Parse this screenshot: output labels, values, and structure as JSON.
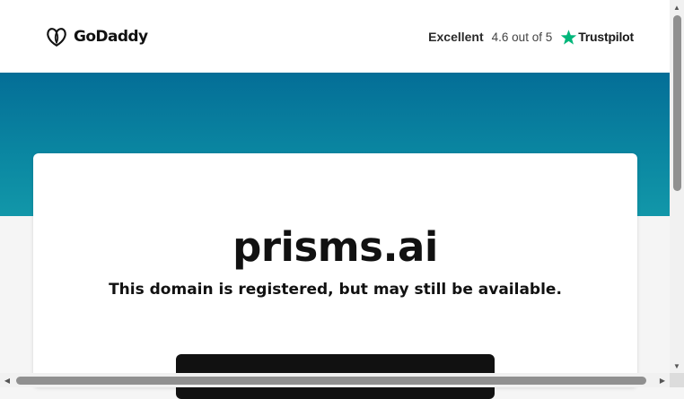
{
  "header": {
    "logo_text": "GoDaddy",
    "rating": {
      "word": "Excellent",
      "score": "4.6 out of 5",
      "brand": "Trustpilot",
      "star_icon": "star-icon",
      "star_color": "#00b67a"
    }
  },
  "hero": {
    "color_top": "#046e97",
    "color_bottom": "#1297a9"
  },
  "card": {
    "domain": "prisms.ai",
    "subtitle": "This domain is registered, but may still be available.",
    "cta_label": ""
  },
  "scrollbars": {
    "up_arrow": "▲",
    "down_arrow": "▼",
    "left_arrow": "◀",
    "right_arrow": "▶"
  }
}
